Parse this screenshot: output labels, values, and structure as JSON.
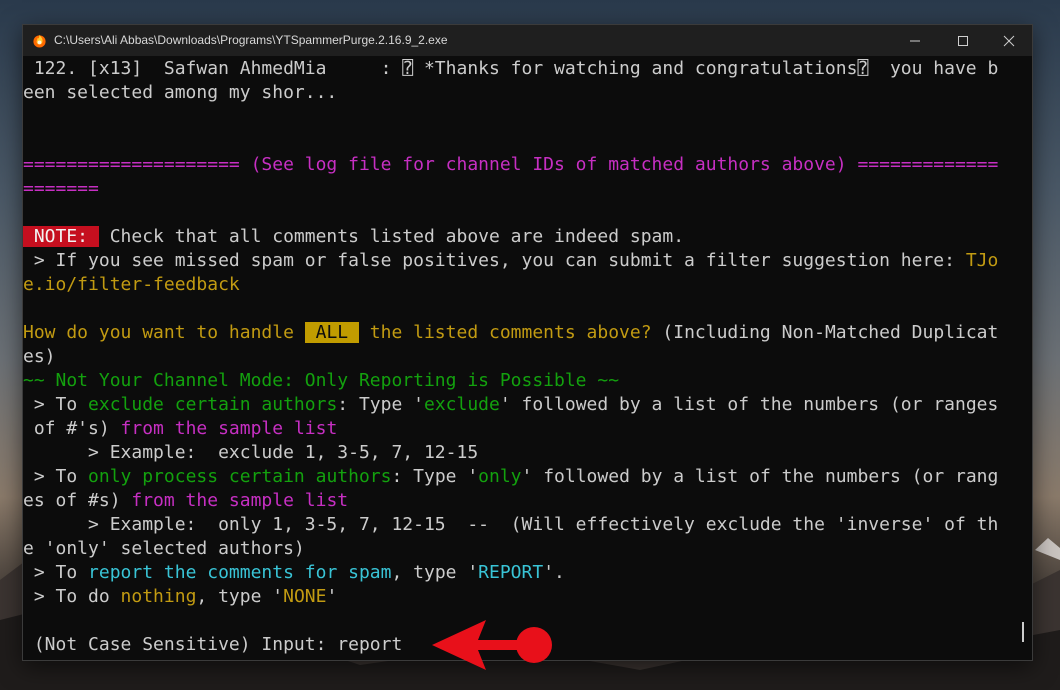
{
  "window": {
    "title": "C:\\Users\\Ali Abbas\\Downloads\\Programs\\YTSpammerPurge.2.16.9_2.exe"
  },
  "terminal": {
    "l1": " 122. [x13]  Safwan AhmedMia     : ⍰ *Thanks for watching and congratulations⍰  you have b",
    "l2": "een selected among my shor...",
    "sep1": "==================== (See log file for channel IDs of matched authors above) =============",
    "sep2": "=======",
    "note_badge": " NOTE: ",
    "note_text": " Check that all comments listed above are indeed spam.",
    "feedback_prefix": " > If you see missed spam or false positives, you can submit a filter suggestion here: ",
    "feedback_link_a": "TJo",
    "feedback_link_b": "e.io/filter-feedback",
    "q_a": "How do you want to handle ",
    "q_all": " ALL ",
    "q_b": " the listed comments above?",
    "q_c": " (Including Non-Matched Duplicat",
    "q_d": "es)",
    "mode": "~~ Not Your Channel Mode: Only Reporting is Possible ~~",
    "ex_a": " > To ",
    "ex_b": "exclude certain authors",
    "ex_c": ": Type '",
    "ex_d": "exclude",
    "ex_e": "' followed by a list of the numbers (or ranges",
    "ex2_a": " of #'s) ",
    "ex2_b": "from the sample list",
    "ex3": "      > Example:  exclude 1, 3-5, 7, 12-15",
    "on_a": " > To ",
    "on_b": "only process certain authors",
    "on_c": ": Type '",
    "on_d": "only",
    "on_e": "' followed by a list of the numbers (or rang",
    "on2_a": "es of #s) ",
    "on2_b": "from the sample list",
    "on3": "      > Example:  only 1, 3-5, 7, 12-15  --  (Will effectively exclude the 'inverse' of th",
    "on4": "e 'only' selected authors)",
    "rep_a": " > To ",
    "rep_b": "report the comments for spam",
    "rep_c": ", type '",
    "rep_d": "REPORT",
    "rep_e": "'.",
    "non_a": " > To do ",
    "non_b": "nothing",
    "non_c": ", type '",
    "non_d": "NONE",
    "non_e": "'",
    "input_label": " (Not Case Sensitive) Input: ",
    "input_value": "report"
  },
  "colors": {
    "magenta": "#c72fc3",
    "yellow": "#c29b12",
    "green": "#13a10e",
    "cyan": "#3a96dd",
    "note_red": "#c50f1f",
    "arrow_red": "#e8101a"
  },
  "icons": {
    "app": "fire-icon",
    "minimize": "minimize-icon",
    "maximize": "maximize-icon",
    "close": "close-icon",
    "annotation": "red-arrow-icon"
  }
}
